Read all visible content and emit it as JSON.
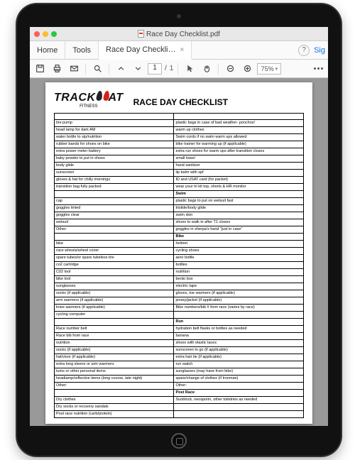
{
  "window": {
    "title": "Race Day Checklist.pdf"
  },
  "tabs": {
    "home": "Home",
    "tools": "Tools",
    "doc": "Race Day Checkli…",
    "help": "?",
    "signin": "Sig"
  },
  "toolbar": {
    "page_current": "1",
    "page_sep": "/",
    "page_total": "1",
    "zoom": "75%"
  },
  "doc": {
    "logo_track": "TRACK",
    "logo_cat": "AT",
    "logo_sub": "FITNESS",
    "title": "RACE DAY CHECKLIST",
    "rows": [
      [
        "",
        ""
      ],
      [
        "tire pump",
        "plastic bags in case of bad weather- ponchos!"
      ],
      [
        "head lamp for dark AM",
        "warm up clothes"
      ],
      [
        "water bottle to sip/nutrition",
        "Swim cords if no swim warm ups allowed"
      ],
      [
        "rubber bands for shoes on bike",
        "bike trainer for warming up (if applicable)"
      ],
      [
        "extra power meter battery",
        "extra run shoes for warm ups after transition closes"
      ],
      [
        "baby powder to put in shoes",
        "small towel"
      ],
      [
        "body glide",
        "hand sanitizer"
      ],
      [
        "sunscreen",
        "lip balm with spf"
      ],
      [
        "gloves & hat for chilly mornings",
        "ID and USAT card (for packet)"
      ],
      [
        "transition bag fully packed",
        "wear your tri kit top, shorts & HR monitor"
      ],
      [
        "",
        "Swim",
        "sec"
      ],
      [
        "cap",
        "plastic bags to put on wetsuit fast"
      ],
      [
        "goggles tinted",
        "trislide/body glide"
      ],
      [
        "goggles clear",
        "swim skin"
      ],
      [
        "wetsuit",
        "shoes to walk in after T1 closes"
      ],
      [
        "Other:",
        "goggles in sherpa's hand \"just in case\""
      ],
      [
        "",
        "Bike",
        "sec"
      ],
      [
        "bike",
        "helmet"
      ],
      [
        "race wheels/wheel cover",
        "cycling shoes"
      ],
      [
        "spare tubes/or spare tubeless tire",
        "aero bottle"
      ],
      [
        "co2 cartridge",
        "bottles"
      ],
      [
        "C02 tool",
        "nutrition"
      ],
      [
        "bike tool",
        "bento box"
      ],
      [
        "sunglasses",
        "electric tape"
      ],
      [
        "socks (if applicable)",
        "gloves, toe warmers (if applicable)"
      ],
      [
        "arm warmers (if applicable)",
        "jersey/jacket (if applicable)"
      ],
      [
        "knee warmers (if applicable)",
        "Bike numbers/bib # from race (varies by race)"
      ],
      [
        "cycling computer",
        ""
      ],
      [
        "",
        "Run",
        "sec"
      ],
      [
        "Race number belt",
        "hydration belt flasks or bottles as needed"
      ],
      [
        "Race bib from race",
        "banana"
      ],
      [
        "nutrition",
        "shoes with elastic laces"
      ],
      [
        "socks (if applicable)",
        "sunscreen to go (if applicable)"
      ],
      [
        "hat/visor (if applicable)",
        "extra hair tie (if applicable)"
      ],
      [
        "extra long sleeve or arm warmers",
        "run watch"
      ],
      [
        "tums or other personal items",
        "sunglasses (may have from bike)"
      ],
      [
        "headlamp/reflective items (long course, late night)",
        "spare/change of clothes (if Ironman)"
      ],
      [
        "Other:",
        "Other:"
      ],
      [
        "",
        "Post Race",
        "sec"
      ],
      [
        "Dry clothes",
        "Sunblock, neosporin, other toiletries as needed"
      ],
      [
        "Dry socks or recovery sandals",
        ""
      ],
      [
        "Post race nutrition (carb/protein)",
        ""
      ]
    ]
  }
}
